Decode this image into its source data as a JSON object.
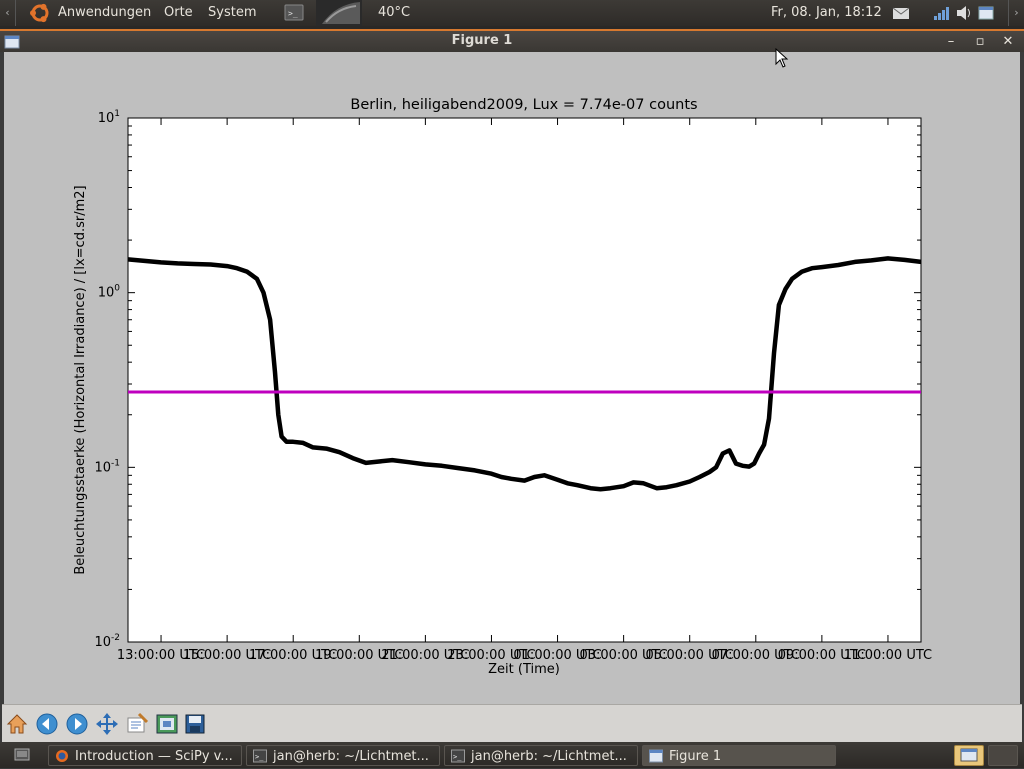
{
  "top_panel": {
    "menus": [
      "Anwendungen",
      "Orte",
      "System"
    ],
    "temperature": "40°C",
    "clock": "Fr, 08. Jan, 18:12"
  },
  "window": {
    "title": "Figure 1",
    "minimize": "–",
    "maximize": "▫",
    "close": "✕"
  },
  "taskbar": {
    "tasks": [
      {
        "label": "Introduction — SciPy v..."
      },
      {
        "label": "jan@herb: ~/Lichtmet..."
      },
      {
        "label": "jan@herb: ~/Lichtmet..."
      },
      {
        "label": "Figure 1"
      }
    ]
  },
  "colors": {
    "threshold": "#bf00bf",
    "series": "#000000",
    "accent": "#d7792f"
  },
  "chart_data": {
    "type": "line",
    "title": "Berlin, heiligabend2009, Lux = 7.74e-07 counts",
    "xlabel": "Zeit (Time)",
    "ylabel": "Beleuchtungsstaerke (Horizontal Irradiance) / [lx=cd.sr/m2]",
    "yscale": "log",
    "ylim": [
      0.01,
      10
    ],
    "xlim_hours": [
      12.0,
      36.0
    ],
    "yticks": [
      {
        "base": "10",
        "exp": "-2"
      },
      {
        "base": "10",
        "exp": "-1"
      },
      {
        "base": "10",
        "exp": "0"
      },
      {
        "base": "10",
        "exp": "1"
      }
    ],
    "ytick_values": [
      0.01,
      0.1,
      1,
      10
    ],
    "xticks": [
      "13:00:00 UTC",
      "15:00:00 UTC",
      "17:00:00 UTC",
      "19:00:00 UTC",
      "21:00:00 UTC",
      "23:00:00 UTC",
      "01:00:00 UTC",
      "03:00:00 UTC",
      "05:00:00 UTC",
      "07:00:00 UTC",
      "09:00:00 UTC",
      "11:00:00 UTC"
    ],
    "xtick_hours": [
      13,
      15,
      17,
      19,
      21,
      23,
      25,
      27,
      29,
      31,
      33,
      35
    ],
    "threshold": {
      "value": 0.27
    },
    "series": [
      {
        "x_hours": [
          12.0,
          12.5,
          13.0,
          13.5,
          14.0,
          14.5,
          15.0,
          15.3,
          15.6,
          15.9,
          16.1,
          16.3,
          16.45,
          16.55,
          16.65,
          16.8,
          17.0,
          17.3,
          17.6,
          18.0,
          18.4,
          18.8,
          19.2,
          19.6,
          20.0,
          20.5,
          21.0,
          21.5,
          22.0,
          22.5,
          23.0,
          23.3,
          23.6,
          24.0,
          24.3,
          24.6,
          25.0,
          25.3,
          25.6,
          26.0,
          26.3,
          26.6,
          27.0,
          27.3,
          27.6,
          28.0,
          28.3,
          28.6,
          29.0,
          29.3,
          29.6,
          29.8,
          30.0,
          30.2,
          30.4,
          30.6,
          30.8,
          30.95,
          31.1,
          31.25,
          31.4,
          31.55,
          31.7,
          31.9,
          32.1,
          32.4,
          32.7,
          33.0,
          33.5,
          34.0,
          34.5,
          35.0,
          35.5,
          36.0
        ],
        "y_values": [
          1.55,
          1.52,
          1.49,
          1.47,
          1.46,
          1.45,
          1.42,
          1.38,
          1.32,
          1.2,
          1.0,
          0.7,
          0.35,
          0.2,
          0.15,
          0.14,
          0.14,
          0.138,
          0.13,
          0.128,
          0.122,
          0.113,
          0.106,
          0.108,
          0.11,
          0.107,
          0.104,
          0.102,
          0.099,
          0.096,
          0.092,
          0.088,
          0.086,
          0.084,
          0.088,
          0.09,
          0.085,
          0.081,
          0.079,
          0.076,
          0.075,
          0.076,
          0.078,
          0.082,
          0.081,
          0.076,
          0.077,
          0.079,
          0.083,
          0.088,
          0.094,
          0.1,
          0.12,
          0.125,
          0.105,
          0.102,
          0.101,
          0.105,
          0.12,
          0.135,
          0.19,
          0.45,
          0.85,
          1.05,
          1.2,
          1.32,
          1.38,
          1.4,
          1.44,
          1.5,
          1.53,
          1.57,
          1.54,
          1.5
        ]
      }
    ]
  }
}
